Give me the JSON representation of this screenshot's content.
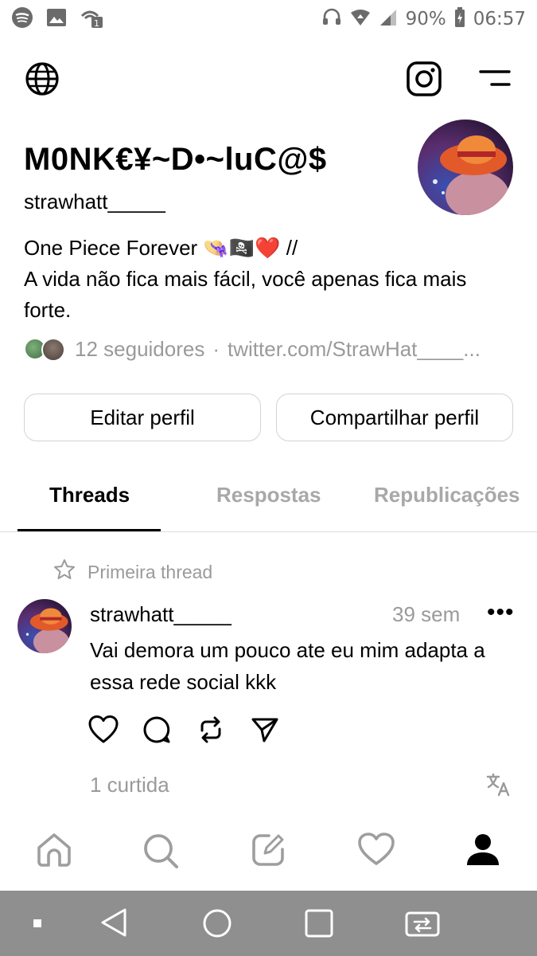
{
  "status_bar": {
    "left_icons": [
      "spotify-icon",
      "image-icon",
      "wifi-calling-icon"
    ],
    "right_icons": [
      "headset-icon",
      "wifi-icon",
      "signal-icon",
      "battery-icon"
    ],
    "battery": "90%",
    "time": "06:57"
  },
  "top_bar": {
    "icons": [
      "globe-icon",
      "instagram-icon",
      "menu-icon"
    ]
  },
  "profile": {
    "display_name": "M0NK€¥~D•~luC@$",
    "handle": "strawhatt_____",
    "bio_line1": "One Piece Forever 👒🏴‍☠️❤️ //",
    "bio_line2": "A vida não fica mais fácil, você apenas fica mais",
    "bio_line3": "forte.",
    "followers": "12 seguidores",
    "separator": "·",
    "link": "twitter.com/StrawHat____..."
  },
  "buttons": {
    "edit": "Editar perfil",
    "share": "Compartilhar perfil"
  },
  "tabs": [
    {
      "label": "Threads",
      "active": true
    },
    {
      "label": "Respostas",
      "active": false
    },
    {
      "label": "Republicações",
      "active": false
    }
  ],
  "post": {
    "pinned_label": "Primeira thread",
    "user": "strawhatt_____",
    "time": "39 sem",
    "more": "•••",
    "text_line1": "Vai demora um pouco ate eu mim adapta a",
    "text_line2": "essa rede social kkk",
    "actions": [
      "heart-icon",
      "comment-icon",
      "repost-icon",
      "send-icon"
    ],
    "likes": "1 curtida"
  },
  "bottom_nav": {
    "items": [
      "home-icon",
      "search-icon",
      "compose-icon",
      "activity-heart-icon",
      "profile-icon"
    ],
    "active": "profile-icon"
  },
  "colors": {
    "muted": "#9a9a9a",
    "border": "#d3d3d3",
    "system_nav": "#8f8f8f"
  }
}
